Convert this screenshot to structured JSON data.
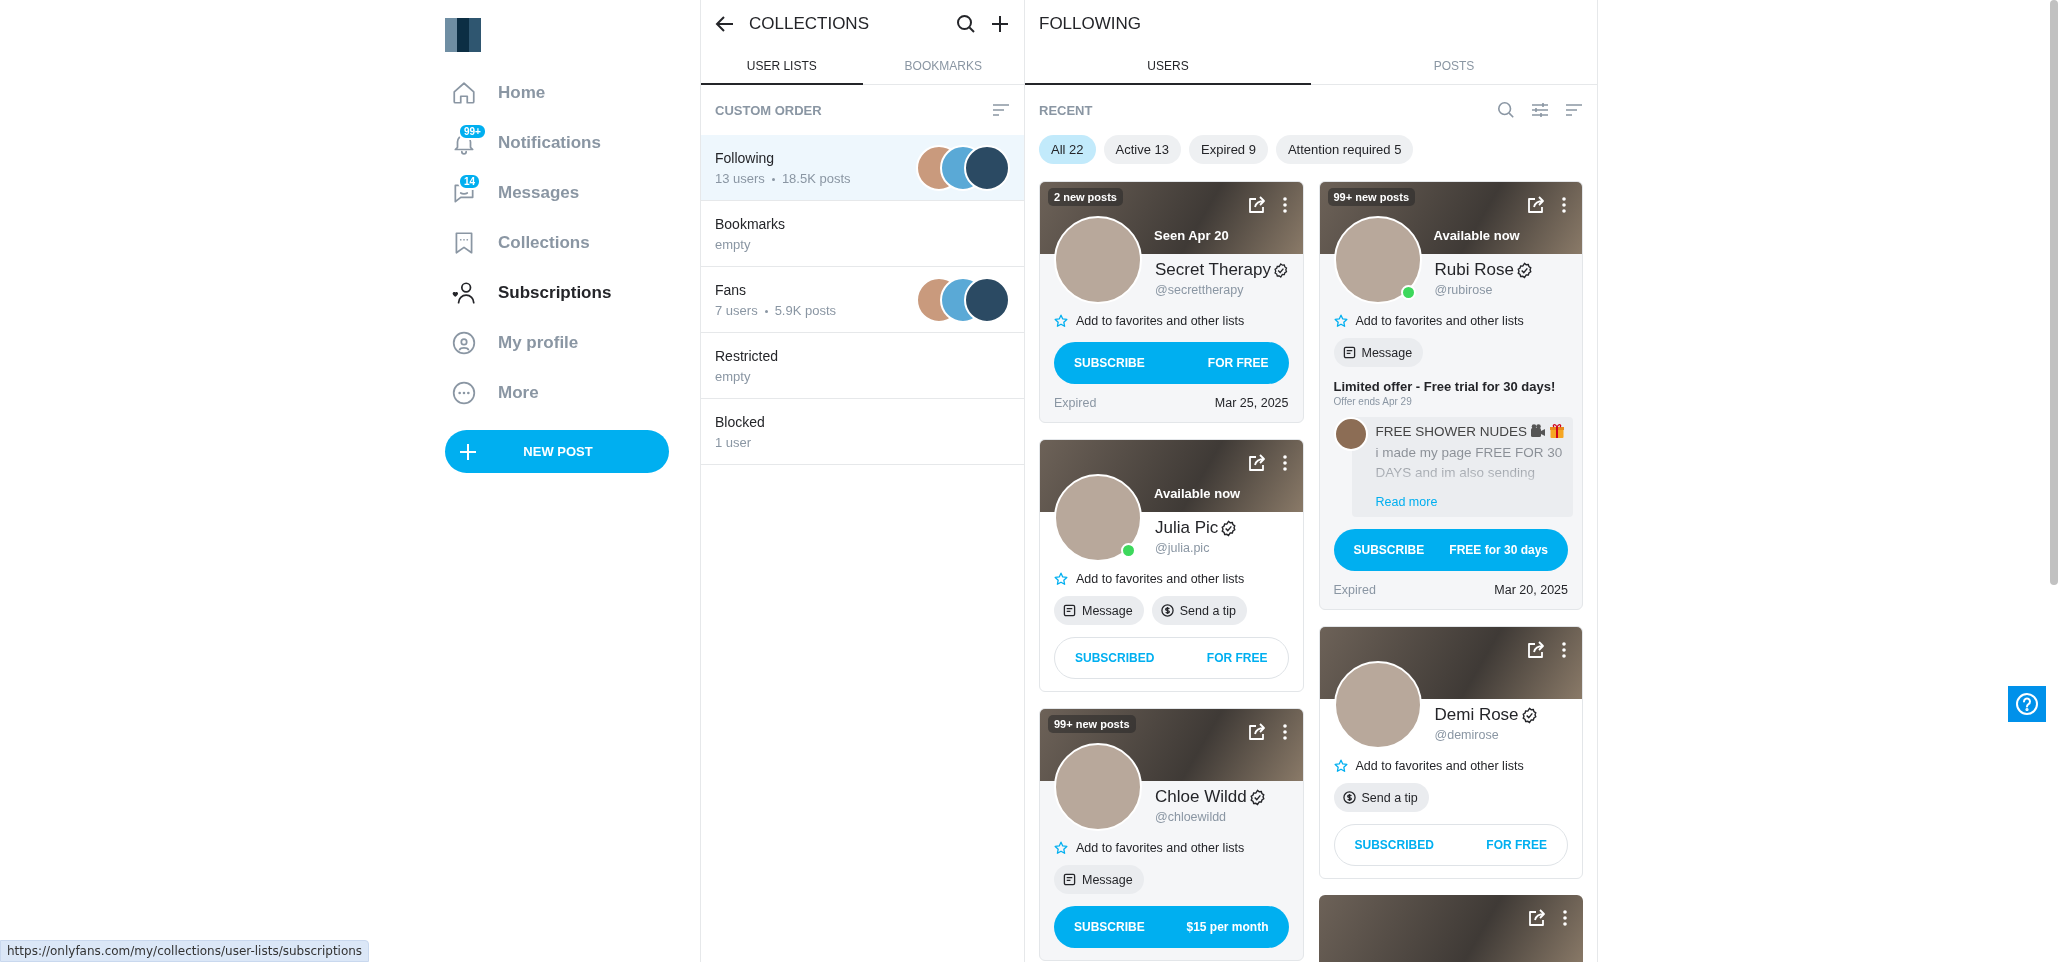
{
  "sidebar": {
    "nav": [
      {
        "label": "Home",
        "selected": false
      },
      {
        "label": "Notifications",
        "selected": false,
        "badge": "99+"
      },
      {
        "label": "Messages",
        "selected": false,
        "badge": "14"
      },
      {
        "label": "Collections",
        "selected": false
      },
      {
        "label": "Subscriptions",
        "selected": true
      },
      {
        "label": "My profile",
        "selected": false
      },
      {
        "label": "More",
        "selected": false
      }
    ],
    "new_post_button": "NEW POST"
  },
  "collections": {
    "title": "COLLECTIONS",
    "tabs": [
      {
        "label": "USER LISTS",
        "selected": true
      },
      {
        "label": "BOOKMARKS",
        "selected": false
      }
    ],
    "section": "CUSTOM ORDER",
    "lists": [
      {
        "name": "Following",
        "meta": [
          "13 users",
          "18.5K posts"
        ],
        "selected": true,
        "has_avatars": true
      },
      {
        "name": "Bookmarks",
        "meta": [
          "empty"
        ],
        "selected": false,
        "has_avatars": false
      },
      {
        "name": "Fans",
        "meta": [
          "7 users",
          "5.9K posts"
        ],
        "selected": false,
        "has_avatars": true
      },
      {
        "name": "Restricted",
        "meta": [
          "empty"
        ],
        "selected": false,
        "has_avatars": false
      },
      {
        "name": "Blocked",
        "meta": [
          "1 user"
        ],
        "selected": false,
        "has_avatars": false
      }
    ]
  },
  "following": {
    "title": "FOLLOWING",
    "tabs": [
      {
        "label": "USERS",
        "selected": true
      },
      {
        "label": "POSTS",
        "selected": false
      }
    ],
    "section": "RECENT",
    "filters": [
      {
        "label": "All 22",
        "selected": true
      },
      {
        "label": "Active 13",
        "selected": false
      },
      {
        "label": "Expired 9",
        "selected": false
      },
      {
        "label": "Attention required 5",
        "selected": false
      }
    ],
    "columns": [
      [
        {
          "expired": true,
          "badge": "2 new posts",
          "status": "Seen Apr 20",
          "name": "Secret Therapy",
          "verified": true,
          "handle": "@secrettherapy",
          "online": false,
          "favorites": "Add to favorites and other lists",
          "button": {
            "kind": "subscribe",
            "label": "SUBSCRIBE",
            "price": "FOR FREE"
          },
          "footer": {
            "status": "Expired",
            "date": "Mar 25, 2025"
          }
        },
        {
          "expired": false,
          "status": "Available now",
          "name": "Julia Pic",
          "verified": true,
          "handle": "@julia.pic",
          "online": true,
          "favorites": "Add to favorites and other lists",
          "actions": [
            {
              "kind": "message",
              "label": "Message"
            },
            {
              "kind": "tip",
              "label": "Send a tip"
            }
          ],
          "button": {
            "kind": "subscribed",
            "label": "SUBSCRIBED",
            "price": "FOR FREE"
          }
        },
        {
          "expired": true,
          "badge": "99+ new posts",
          "name": "Chloe Wildd",
          "verified": true,
          "handle": "@chloewildd",
          "online": false,
          "favorites": "Add to favorites and other lists",
          "actions": [
            {
              "kind": "message",
              "label": "Message"
            }
          ],
          "button": {
            "kind": "subscribe",
            "label": "SUBSCRIBE",
            "price": "$15 per month"
          }
        }
      ],
      [
        {
          "expired": true,
          "badge": "99+ new posts",
          "status": "Available now",
          "name": "Rubi Rose",
          "verified": true,
          "handle": "@rubirose",
          "online": true,
          "favorites": "Add to favorites and other lists",
          "actions": [
            {
              "kind": "message",
              "label": "Message"
            }
          ],
          "offer": {
            "title": "Limited offer - Free trial for 30 days!",
            "ends": "Offer ends Apr 29",
            "headline": "FREE SHOWER NUDES",
            "body": "i made my page FREE FOR 30 DAYS and im also sending",
            "read_more": "Read more"
          },
          "button": {
            "kind": "subscribe",
            "label": "SUBSCRIBE",
            "price": "FREE for 30 days"
          },
          "footer": {
            "status": "Expired",
            "date": "Mar 20, 2025"
          }
        },
        {
          "expired": false,
          "name": "Demi Rose",
          "verified": true,
          "handle": "@demirose",
          "online": false,
          "favorites": "Add to favorites and other lists",
          "actions": [
            {
              "kind": "tip",
              "label": "Send a tip"
            }
          ],
          "button": {
            "kind": "subscribed",
            "label": "SUBSCRIBED",
            "price": "FOR FREE"
          }
        },
        {
          "kind": "banner"
        }
      ]
    ]
  },
  "status_bar": {
    "url": "https://onlyfans.com/my/collections/user-lists/subscriptions"
  }
}
